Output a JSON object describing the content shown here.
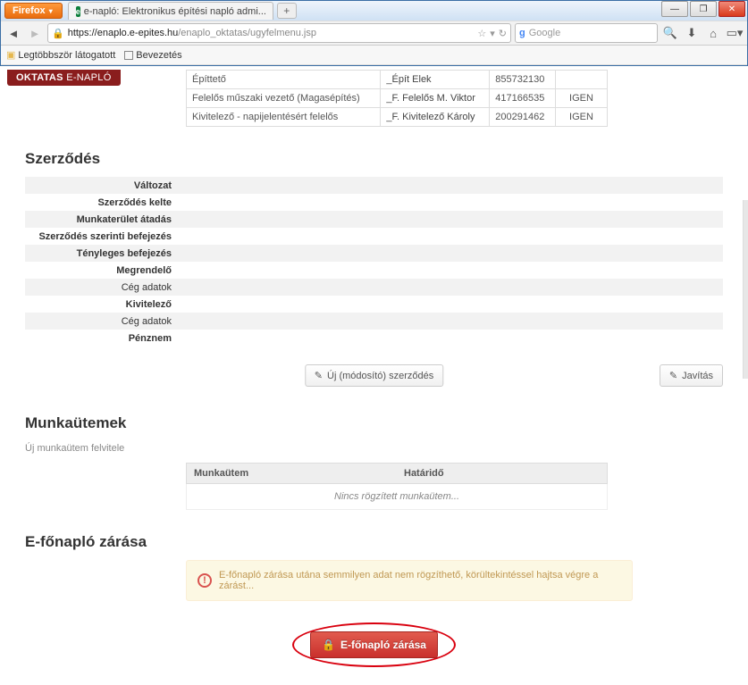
{
  "browser": {
    "name": "Firefox",
    "tab_title": "e-napló: Elektronikus építési napló admi...",
    "url_host": "https://enaplo.e-epites.hu",
    "url_path": "/enaplo_oktatas/ugyfelmenu.jsp",
    "search_placeholder": "Google",
    "bookmarks": {
      "most_visited": "Legtöbbször látogatott",
      "intro": "Bevezetés"
    }
  },
  "brand": {
    "left": "OKTATAS",
    "right": "E-NAPLÓ"
  },
  "roles": [
    {
      "role": "Építtető",
      "name": "_Épít Elek",
      "id": "855732130",
      "flag": ""
    },
    {
      "role": "Felelős műszaki vezető (Magasépítés)",
      "name": "_F. Felelős M. Viktor",
      "id": "417166535",
      "flag": "IGEN"
    },
    {
      "role": "Kivitelező - napijelentésért felelős",
      "name": "_F. Kivitelező Károly",
      "id": "200291462",
      "flag": "IGEN"
    }
  ],
  "contract": {
    "heading": "Szerződés",
    "rows": [
      {
        "label": "Változat",
        "bold": true
      },
      {
        "label": "Szerződés kelte",
        "bold": true
      },
      {
        "label": "Munkaterület átadás",
        "bold": true
      },
      {
        "label": "Szerződés szerinti befejezés",
        "bold": true
      },
      {
        "label": "Tényleges befejezés",
        "bold": true
      },
      {
        "label": "Megrendelő",
        "bold": true
      },
      {
        "label": "Cég adatok",
        "bold": false
      },
      {
        "label": "Kivitelező",
        "bold": true
      },
      {
        "label": "Cég adatok",
        "bold": false
      },
      {
        "label": "Pénznem",
        "bold": true
      }
    ],
    "edit_btn": "Javítás",
    "new_btn": "Új (módosító) szerződés"
  },
  "workitems": {
    "heading": "Munkaütemek",
    "add_link": "Új munkaütem felvitele",
    "col1": "Munkaütem",
    "col2": "Határidő",
    "empty": "Nincs rögzített munkaütem..."
  },
  "close": {
    "heading": "E-főnapló zárása",
    "warning": "E-főnapló zárása utána semmilyen adat nem rögzíthető, körültekintéssel hajtsa végre a zárást...",
    "button": "E-főnapló zárása"
  },
  "icons": {
    "refresh": "⟲",
    "edit": "✎",
    "lock": "🔒"
  }
}
